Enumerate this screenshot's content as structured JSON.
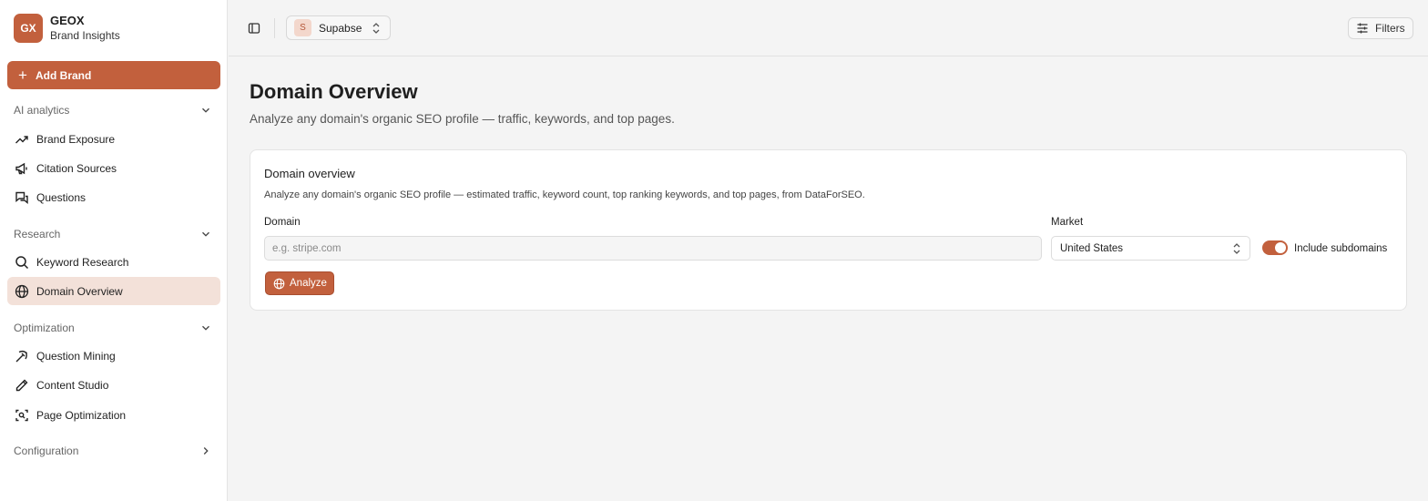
{
  "brand": {
    "logo_text": "GX",
    "name": "GEOX",
    "subtitle": "Brand Insights"
  },
  "sidebar": {
    "add_label": "Add Brand",
    "sections": [
      {
        "label": "AI analytics",
        "items": [
          "Brand Exposure",
          "Citation Sources",
          "Questions"
        ]
      },
      {
        "label": "Research",
        "items": [
          "Keyword Research",
          "Domain Overview"
        ]
      },
      {
        "label": "Optimization",
        "items": [
          "Question Mining",
          "Content Studio",
          "Page Optimization"
        ]
      },
      {
        "label": "Configuration",
        "items": []
      }
    ],
    "active_item": "Domain Overview"
  },
  "topbar": {
    "project_badge": "S",
    "project_name": "Supabse",
    "filters_label": "Filters"
  },
  "page": {
    "title": "Domain Overview",
    "subtitle": "Analyze any domain's organic SEO profile — traffic, keywords, and top pages."
  },
  "card": {
    "title": "Domain overview",
    "description": "Analyze any domain's organic SEO profile — estimated traffic, keyword count, top ranking keywords, and top pages, from DataForSEO.",
    "domain_label": "Domain",
    "domain_placeholder": "e.g. stripe.com",
    "domain_value": "",
    "market_label": "Market",
    "market_value": "United States",
    "subdomains_label": "Include subdomains",
    "subdomains_enabled": true,
    "analyze_label": "Analyze"
  },
  "colors": {
    "accent": "#c2603d",
    "active_bg": "#f3e1d9"
  }
}
